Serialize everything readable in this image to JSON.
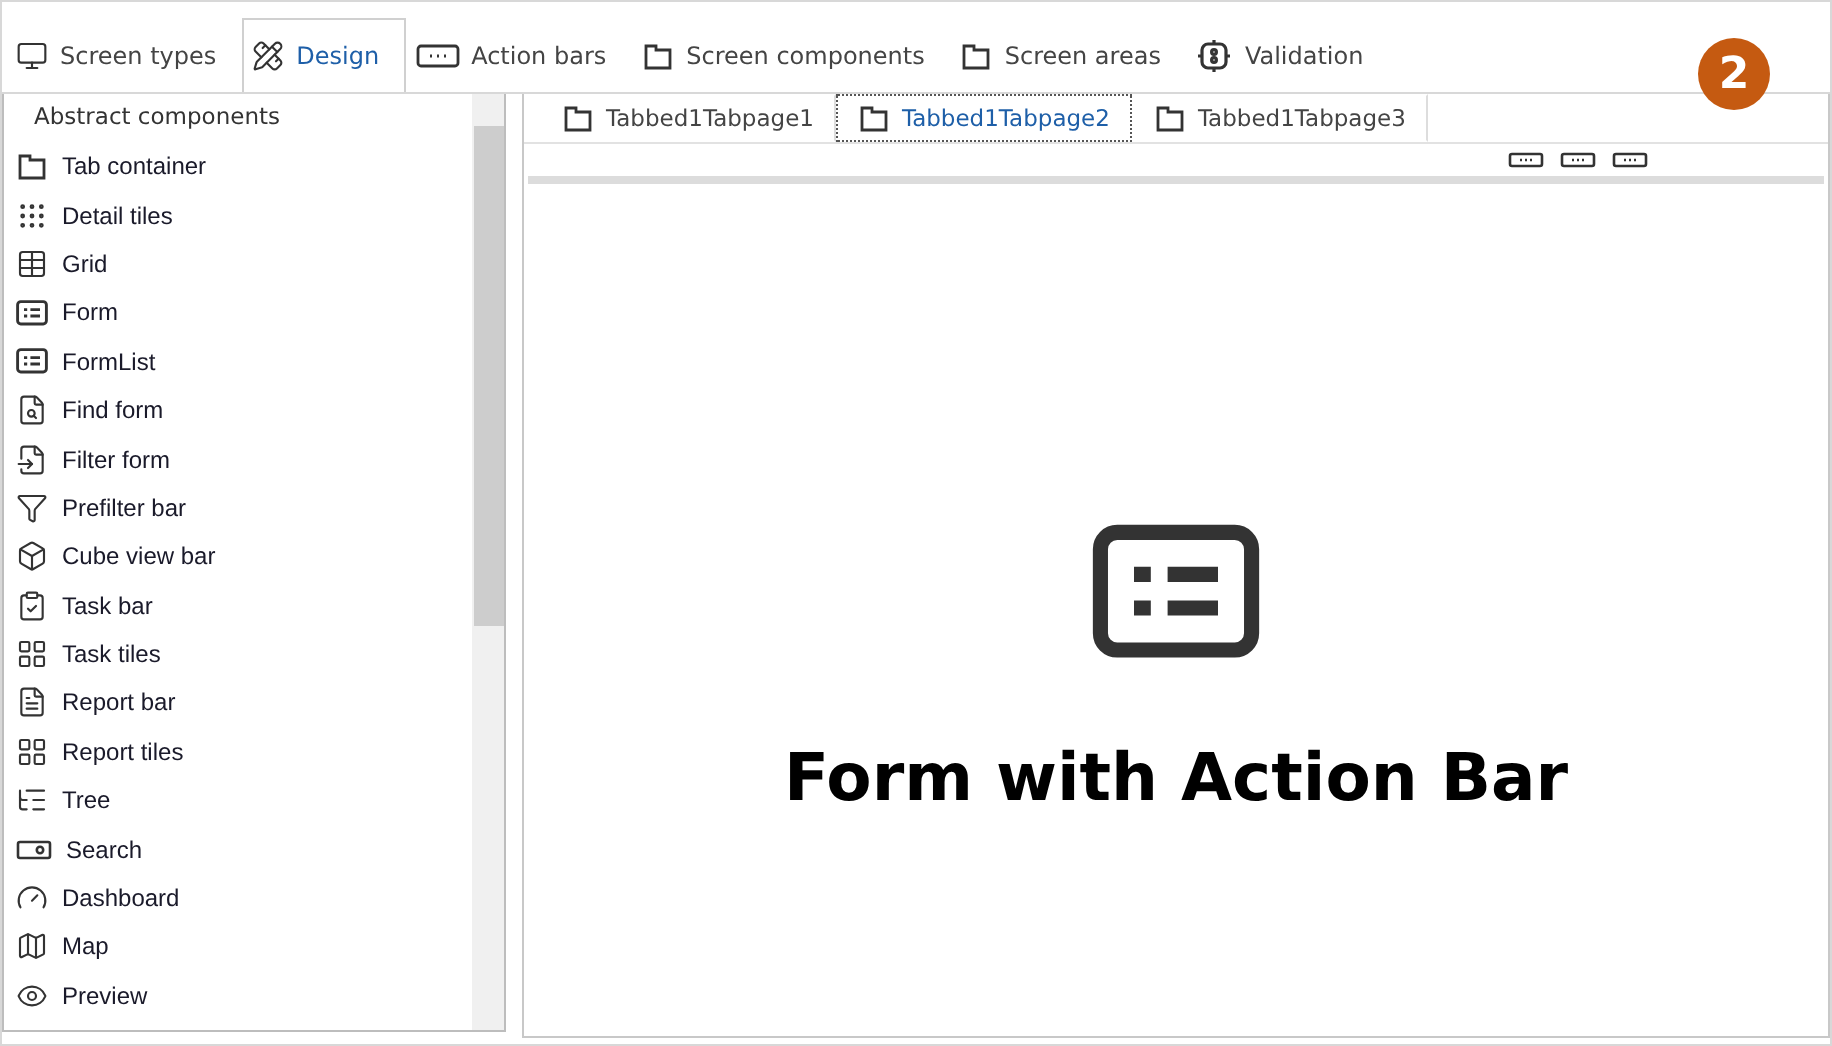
{
  "main_tabs": [
    {
      "label": "Screen types",
      "selected": false
    },
    {
      "label": "Design",
      "selected": true
    },
    {
      "label": "Action bars",
      "selected": false
    },
    {
      "label": "Screen components",
      "selected": false
    },
    {
      "label": "Screen areas",
      "selected": false
    },
    {
      "label": "Validation",
      "selected": false
    }
  ],
  "badge": "2",
  "sidebar": {
    "title": "Abstract components",
    "items": [
      {
        "label": "Tab container"
      },
      {
        "label": "Detail tiles"
      },
      {
        "label": "Grid"
      },
      {
        "label": "Form"
      },
      {
        "label": "FormList"
      },
      {
        "label": "Find form"
      },
      {
        "label": "Filter form"
      },
      {
        "label": "Prefilter bar"
      },
      {
        "label": "Cube view bar"
      },
      {
        "label": "Task bar"
      },
      {
        "label": "Task tiles"
      },
      {
        "label": "Report bar"
      },
      {
        "label": "Report tiles"
      },
      {
        "label": "Tree"
      },
      {
        "label": "Search"
      },
      {
        "label": "Dashboard"
      },
      {
        "label": "Map"
      },
      {
        "label": "Preview"
      }
    ]
  },
  "page_tabs": [
    {
      "label": "Tabbed1Tabpage1",
      "selected": false
    },
    {
      "label": "Tabbed1Tabpage2",
      "selected": true
    },
    {
      "label": "Tabbed1Tabpage3",
      "selected": false
    }
  ],
  "canvas": {
    "heading": "Form with Action Bar"
  }
}
